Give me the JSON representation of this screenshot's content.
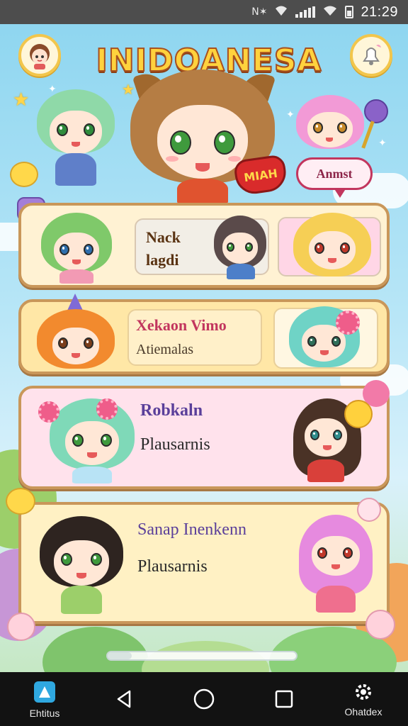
{
  "status_bar": {
    "carrier_icons": "N✶",
    "time": "21:29"
  },
  "header": {
    "title": "INIDOANESA"
  },
  "speech_bubble": "Anmst",
  "heart_sign": "MIAH",
  "cards": [
    {
      "line1": "Nack",
      "line2": "lagdi"
    },
    {
      "line1": "Xekaon Vimo",
      "line2": "Atiemalas"
    },
    {
      "line1": "Robkaln",
      "line2": "Plausarnis"
    },
    {
      "line1": "Sanap Inenkenn",
      "line2": "Plausarnis"
    }
  ],
  "nav": {
    "left_label": "Ehtitus",
    "right_label": "Ohatdex"
  },
  "colors": {
    "title_fill": "#ffd23d",
    "title_outline": "#a8501f",
    "card_border": "#c9975a",
    "nav_bg": "#121212",
    "status_bg": "#4d4d4d"
  }
}
